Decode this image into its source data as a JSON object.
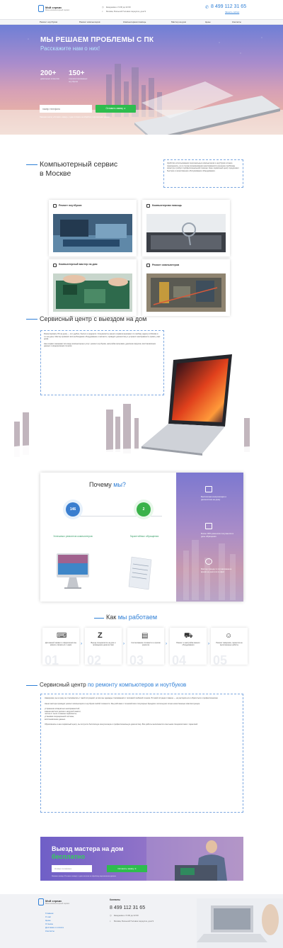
{
  "header": {
    "logo_title": "Мой сервис",
    "logo_sub": "Мини-компьютерный сервис",
    "hours": "Ежедневно с 9:00 до 22:00",
    "address": "Москва, Большой Головин переулок, дом 9",
    "phone": "8 499 112 31 65",
    "callback": "Звонить сейчас"
  },
  "nav": [
    "Ремонт ноутбуков",
    "Ремонт компьютеров",
    "Компьютерная помощь",
    "Мастер на дом",
    "Цены",
    "Контакты"
  ],
  "hero": {
    "title": "МЫ РЕШАЕМ ПРОБЛЕМЫ С ПК",
    "subtitle": "Расскажите нам о них!",
    "stat1_num": "200+",
    "stat1_txt": "довольных клиентов",
    "stat2_num": "150+",
    "stat2_txt": "отремонтированных ноутбуков",
    "input_placeholder": "номер телефона",
    "button": "Оставить заявку",
    "note": "Нажимая кнопку «Оставить заявку», я даю согласие на обработку персональных данных"
  },
  "service": {
    "title_1": "Компьютерный сервис",
    "title_2": "в Москве",
    "info": "Удобство использования персональных компьютеров и ноутбуков сложно переоценить, но в случае возникновения неисправности решение проблемы зачастую требует профессиональной помощи. Наш сервисный центр предлагает быстрое и качественное обслуживание оборудования."
  },
  "cards": [
    {
      "title": "Ремонт ноутбуков"
    },
    {
      "title": "Компьютерная помощь"
    },
    {
      "title": "Компьютерный мастер на дом"
    },
    {
      "title": "Ремонт компьютеров"
    }
  ],
  "center": {
    "title": "Сервисный центр с выездом на дом",
    "p1": "Ремонтировать ПК на дому — это удобно, быстро и недорого. Специалисты нашего сервиса выезжают по любому адресу в Москве в тот же день. Мастер привезёт всё необходимое оборудование и запчасти, проведёт диагностику и устранит неисправность прямо у вас дома.",
    "p2": "Наш сервис оказывает все виды компьютерных услуг: ремонт ноутбуков, настройка программ, удаление вирусов, восстановление данных и модернизация техники."
  },
  "why": {
    "title_a": "Почему ",
    "title_b": "мы?",
    "n1": "146",
    "l1": "Успешных ремонтов компьютеров",
    "n2": "2",
    "l2": "Гарантийных обращения",
    "items": [
      "Бесплатная консультация и диагностика на дому",
      "Более 30% ремонтов получаются в день обращения",
      "Мастер приедет в согласованное время на дом или в офис"
    ]
  },
  "how": {
    "title_a": "Как ",
    "title_b": "мы работаем",
    "steps": [
      {
        "num": "01",
        "text": "Для вашей заявки и оформлении вы можете связаться с нами"
      },
      {
        "num": "02",
        "text": "Выезд специалиста на дом и проведение диагностики"
      },
      {
        "num": "03",
        "text": "Согласование стоимости и сроков ремонта"
      },
      {
        "num": "04",
        "text": "Ремонт и настройка вашего оборудования"
      },
      {
        "num": "05",
        "text": "Ремонт завершён, гарантия на выполненные работы"
      }
    ]
  },
  "repair": {
    "title_a": "Сервисный центр ",
    "title_b": "по ремонту компьютеров и ноутбуков",
    "p1": "Наверняка, вы ни разу не сталкивались с такой ситуацией, но все мы однажды сталкиваемся с поломкой любимой техники. В такой ситуации главное — не растеряться и обратиться к профессионалам.",
    "p2": "Наши мастера проводят ремонт компьютеров и ноутбуков любой сложности. Мы работаем с техникой всех популярных брендов и используем только качественные комплектующие.",
    "list": [
      "устранение аппаратных неисправностей;",
      "замена жёстких дисков и модулей памяти;",
      "чистка от пыли и замена термопасты;",
      "установка операционной системы;",
      "восстановление данных."
    ],
    "p3": "Обратившись в наш сервисный центр, вы получите бесплатную консультацию и профессиональную диагностику. Все работы выполняются опытными специалистами с гарантией."
  },
  "banner": {
    "title": "Выезд мастера на дом",
    "subtitle": "бесплатно",
    "input_placeholder": "Номер телефона",
    "button": "Оставить заявку",
    "note": "Нажимая кнопку «Оставить заявку», я даю согласие на обработку персональных данных"
  },
  "footer": {
    "logo_title": "Мой сервис",
    "logo_sub": "Мини-компьютерный сервис",
    "links": [
      "Главная",
      "О нас",
      "Цены",
      "Отзывы",
      "Доставка и оплата",
      "Контакты"
    ],
    "contacts_label": "Контакты",
    "phone": "8 499 112 31 65",
    "hours": "Ежедневно с 9:00 до 22:00",
    "address": "Москва, Большой Головин переулок, дом 9"
  }
}
